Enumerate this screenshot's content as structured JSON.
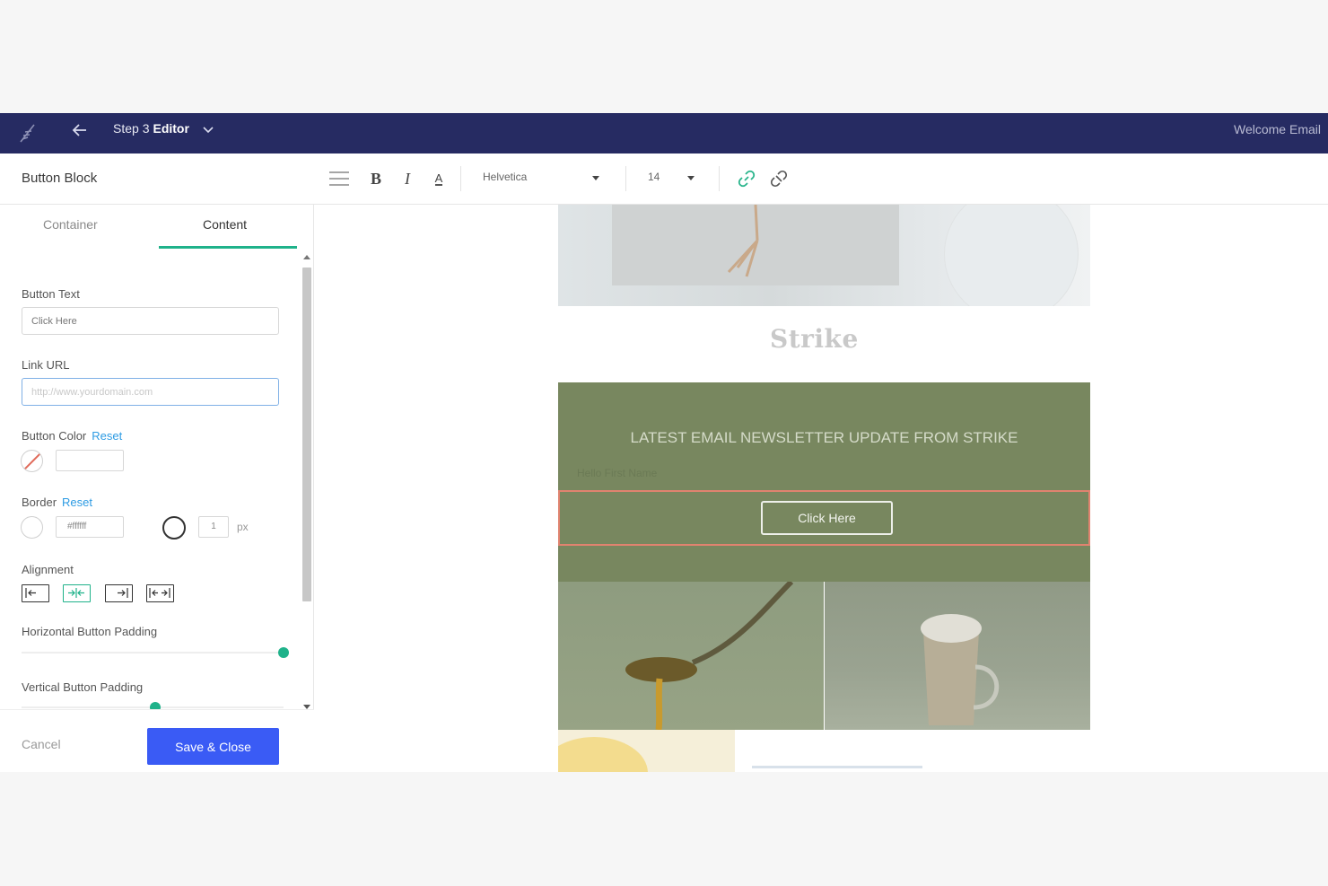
{
  "topbar": {
    "logo_icon": "quill-logo-icon",
    "back_icon": "arrow-left-icon",
    "step": "Step 3",
    "step_name": "Editor",
    "dropdown_icon": "chevron-down-icon",
    "campaign_name": "Welcome Email",
    "color": "#262b62"
  },
  "toolbar": {
    "block_title": "Button Block",
    "menu_icon": "hamburger-icon",
    "bold": "B",
    "italic": "I",
    "font_color": "A",
    "font_family": "Helvetica",
    "font_size": "14",
    "link_icon": "link-icon",
    "unlink_icon": "unlink-icon"
  },
  "sidebar": {
    "tabs": [
      {
        "label": "Container",
        "active": false
      },
      {
        "label": "Content",
        "active": true
      }
    ],
    "button_text": {
      "label": "Button Text",
      "value": "Click Here"
    },
    "link_url": {
      "label": "Link URL",
      "placeholder": "http://www.yourdomain.com"
    },
    "button_color": {
      "label": "Button Color",
      "reset": "Reset",
      "value": ""
    },
    "border": {
      "label": "Border",
      "reset": "Reset",
      "color": "#ffffff",
      "width": "1",
      "unit": "px"
    },
    "alignment": {
      "label": "Alignment",
      "options": [
        "left",
        "center",
        "right",
        "full"
      ],
      "selected": "center"
    },
    "horizontal_padding": {
      "label": "Horizontal Button Padding",
      "value_fraction": 1.0
    },
    "vertical_padding": {
      "label": "Vertical Button Padding",
      "value_fraction": 0.5
    },
    "cancel": "Cancel",
    "save": "Save & Close",
    "accent": "#1fb28a",
    "save_color": "#3a5bf5"
  },
  "email": {
    "brand": "Strike",
    "headline": "LATEST EMAIL NEWSLETTER UPDATE FROM STRIKE",
    "greeting": "Hello First Name",
    "button_label": "Click Here",
    "section_color": "#78875f",
    "selection_color": "#e0836f"
  }
}
